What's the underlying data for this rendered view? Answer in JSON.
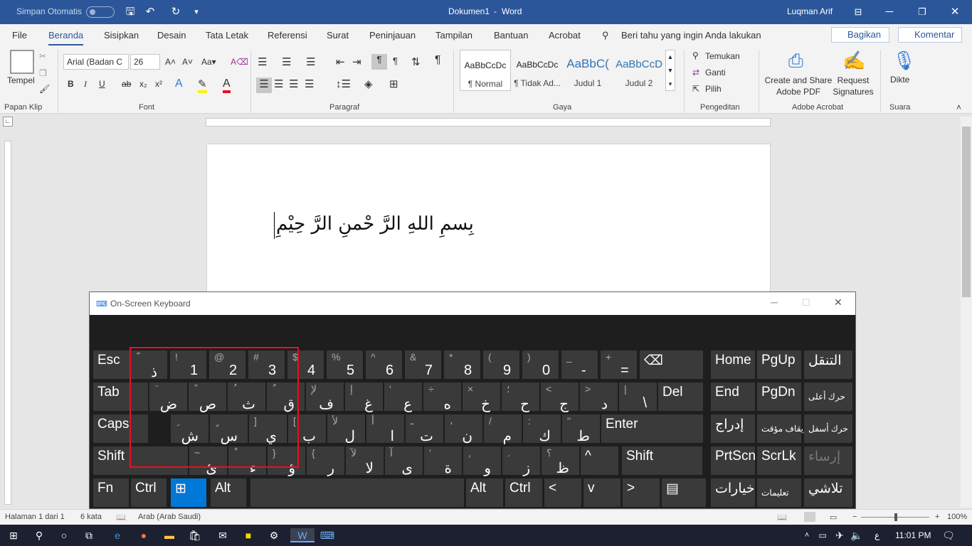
{
  "titlebar": {
    "autosave_label": "Simpan Otomatis",
    "doc_title": "Dokumen1",
    "separator": "-",
    "app_name": "Word",
    "user": "Luqman Arif"
  },
  "menu": {
    "items": [
      "File",
      "Beranda",
      "Sisipkan",
      "Desain",
      "Tata Letak",
      "Referensi",
      "Surat",
      "Peninjauan",
      "Tampilan",
      "Bantuan",
      "Acrobat"
    ],
    "active": "Beranda",
    "tell_me": "Beri tahu yang ingin Anda lakukan",
    "share": "Bagikan",
    "comments": "Komentar"
  },
  "ribbon": {
    "paste_label": "Tempel",
    "clipboard_group": "Papan Klip",
    "font_name": "Arial (Badan C",
    "font_size": "26",
    "font_group": "Font",
    "paragraph_group": "Paragraf",
    "styles_group": "Gaya",
    "styles": [
      {
        "preview": "AaBbCcDc",
        "name": "¶ Normal"
      },
      {
        "preview": "AaBbCcDc",
        "name": "¶ Tidak Ad..."
      },
      {
        "preview": "AaBbC(",
        "name": "Judul 1"
      },
      {
        "preview": "AaBbCcD",
        "name": "Judul 2"
      }
    ],
    "find": "Temukan",
    "replace": "Ganti",
    "select": "Pilih",
    "editing_group": "Pengeditan",
    "create_pdf": "Create and Share Adobe PDF",
    "request_signatures": "Request Signatures",
    "adobe_group": "Adobe Acrobat",
    "dictate": "Dikte",
    "voice_group": "Suara",
    "bold": "B",
    "italic": "I",
    "underline": "U",
    "strike": "ab"
  },
  "document": {
    "text": "بِسمِ اللهِ الرَّ حْمنِ الرَّ حِيْمِ"
  },
  "status": {
    "page": "Halaman 1 dari 1",
    "words": "6 kata",
    "language": "Arab (Arab Saudi)",
    "zoom": "100%"
  },
  "osk": {
    "title": "On-Screen Keyboard",
    "row1": [
      {
        "main": "Esc"
      },
      {
        "sym": "ّ",
        "ar": "ذ"
      },
      {
        "sym": "!",
        "num": "1"
      },
      {
        "sym": "@",
        "num": "2"
      },
      {
        "sym": "#",
        "num": "3"
      },
      {
        "sym": "$",
        "num": "4"
      },
      {
        "sym": "%",
        "num": "5"
      },
      {
        "sym": "^",
        "num": "6"
      },
      {
        "sym": "&",
        "num": "7"
      },
      {
        "sym": "*",
        "num": "8"
      },
      {
        "sym": "(",
        "num": "9"
      },
      {
        "sym": ")",
        "num": "0"
      },
      {
        "sym": "_",
        "num": "-"
      },
      {
        "sym": "+",
        "num": "="
      },
      {
        "main": "⌫"
      },
      {
        "main": "Home"
      },
      {
        "main": "PgUp"
      },
      {
        "main": "التنقل"
      }
    ],
    "row2": [
      {
        "main": "Tab"
      },
      {
        "sym": "َ",
        "ar": "ض"
      },
      {
        "sym": "ً",
        "ar": "ص"
      },
      {
        "sym": "ُ",
        "ar": "ث"
      },
      {
        "sym": "ٌ",
        "ar": "ق"
      },
      {
        "sym": "لإ",
        "ar": "ف"
      },
      {
        "sym": "إ",
        "ar": "غ"
      },
      {
        "sym": "‘",
        "ar": "ع"
      },
      {
        "sym": "÷",
        "ar": "ه"
      },
      {
        "sym": "×",
        "ar": "خ"
      },
      {
        "sym": "؛",
        "ar": "ح"
      },
      {
        "sym": "<",
        "ar": "ج"
      },
      {
        "sym": ">",
        "ar": "د"
      },
      {
        "sym": "|",
        "ar": "\\"
      },
      {
        "main": "Del"
      },
      {
        "main": "End"
      },
      {
        "main": "PgDn"
      },
      {
        "main": "حرك أعلى"
      }
    ],
    "row3": [
      {
        "main": "Caps"
      },
      {
        "sym": "ِ",
        "ar": "ش"
      },
      {
        "sym": "ٍ",
        "ar": "س"
      },
      {
        "sym": "]",
        "ar": "ي"
      },
      {
        "sym": "[",
        "ar": "ب"
      },
      {
        "sym": "لأ",
        "ar": "ل"
      },
      {
        "sym": "أ",
        "ar": "ا"
      },
      {
        "sym": "ـ",
        "ar": "ت"
      },
      {
        "sym": "،",
        "ar": "ن"
      },
      {
        "sym": "/",
        "ar": "م"
      },
      {
        "sym": ":",
        "ar": "ك"
      },
      {
        "sym": "\"",
        "ar": "ط"
      },
      {
        "main": "Enter"
      },
      {
        "main": "إدراج"
      },
      {
        "main": "إيقاف مؤقت"
      },
      {
        "main": "حرك أسفل"
      }
    ],
    "row4": [
      {
        "main": "Shift"
      },
      {
        "sym": "~",
        "ar": "ئ"
      },
      {
        "sym": "ْ",
        "ar": "ء"
      },
      {
        "sym": "}",
        "ar": "ؤ"
      },
      {
        "sym": "{",
        "ar": "ر"
      },
      {
        "sym": "لآ",
        "ar": "لا"
      },
      {
        "sym": "آ",
        "ar": "ى"
      },
      {
        "sym": "’",
        "ar": "ة"
      },
      {
        "sym": ",",
        "ar": "و"
      },
      {
        "sym": ".",
        "ar": "ز"
      },
      {
        "sym": "؟",
        "ar": "ظ"
      },
      {
        "main": "^"
      },
      {
        "main": "Shift"
      },
      {
        "main": "PrtScn"
      },
      {
        "main": "ScrLk"
      },
      {
        "main": "إرساء"
      }
    ],
    "row5": [
      {
        "main": "Fn"
      },
      {
        "main": "Ctrl"
      },
      {
        "main": "⊞"
      },
      {
        "main": "Alt"
      },
      {
        "main": ""
      },
      {
        "main": "Alt"
      },
      {
        "main": "Ctrl"
      },
      {
        "main": "<"
      },
      {
        "main": "v"
      },
      {
        "main": ">"
      },
      {
        "main": "▤"
      },
      {
        "main": "خيارات"
      },
      {
        "main": "تعليمات"
      },
      {
        "main": "تلاشي"
      }
    ]
  },
  "taskbar": {
    "time": "11:01 PM",
    "lang": "ع"
  }
}
